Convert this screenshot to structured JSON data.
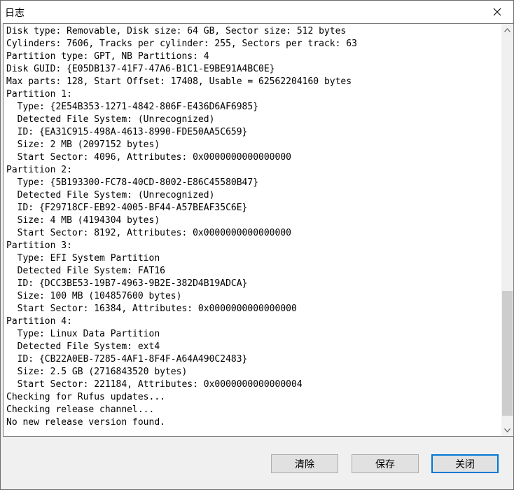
{
  "window": {
    "title": "日志"
  },
  "log": {
    "lines": [
      "Disk type: Removable, Disk size: 64 GB, Sector size: 512 bytes",
      "Cylinders: 7606, Tracks per cylinder: 255, Sectors per track: 63",
      "Partition type: GPT, NB Partitions: 4",
      "Disk GUID: {E05DB137-41F7-47A6-B1C1-E9BE91A4BC0E}",
      "Max parts: 128, Start Offset: 17408, Usable = 62562204160 bytes",
      "Partition 1:",
      "  Type: {2E54B353-1271-4842-806F-E436D6AF6985}",
      "  Detected File System: (Unrecognized)",
      "  ID: {EA31C915-498A-4613-8990-FDE50AA5C659}",
      "  Size: 2 MB (2097152 bytes)",
      "  Start Sector: 4096, Attributes: 0x0000000000000000",
      "Partition 2:",
      "  Type: {5B193300-FC78-40CD-8002-E86C45580B47}",
      "  Detected File System: (Unrecognized)",
      "  ID: {F29718CF-EB92-4005-BF44-A57BEAF35C6E}",
      "  Size: 4 MB (4194304 bytes)",
      "  Start Sector: 8192, Attributes: 0x0000000000000000",
      "Partition 3:",
      "  Type: EFI System Partition",
      "  Detected File System: FAT16",
      "  ID: {DCC3BE53-19B7-4963-9B2E-382D4B19ADCA}",
      "  Size: 100 MB (104857600 bytes)",
      "  Start Sector: 16384, Attributes: 0x0000000000000000",
      "Partition 4:",
      "  Type: Linux Data Partition",
      "  Detected File System: ext4",
      "  ID: {CB22A0EB-7285-4AF1-8F4F-A64A490C2483}",
      "  Size: 2.5 GB (2716843520 bytes)",
      "  Start Sector: 221184, Attributes: 0x0000000000000004",
      "Checking for Rufus updates...",
      "Checking release channel...",
      "No new release version found."
    ]
  },
  "buttons": {
    "clear_label": "清除",
    "save_label": "保存",
    "close_label": "关闭"
  },
  "icons": {
    "close": "close-icon",
    "scroll_up": "chevron-up-icon",
    "scroll_down": "chevron-down-icon"
  },
  "colors": {
    "default_button_border": "#0078d7",
    "scroll_thumb": "#cdcdcd"
  }
}
